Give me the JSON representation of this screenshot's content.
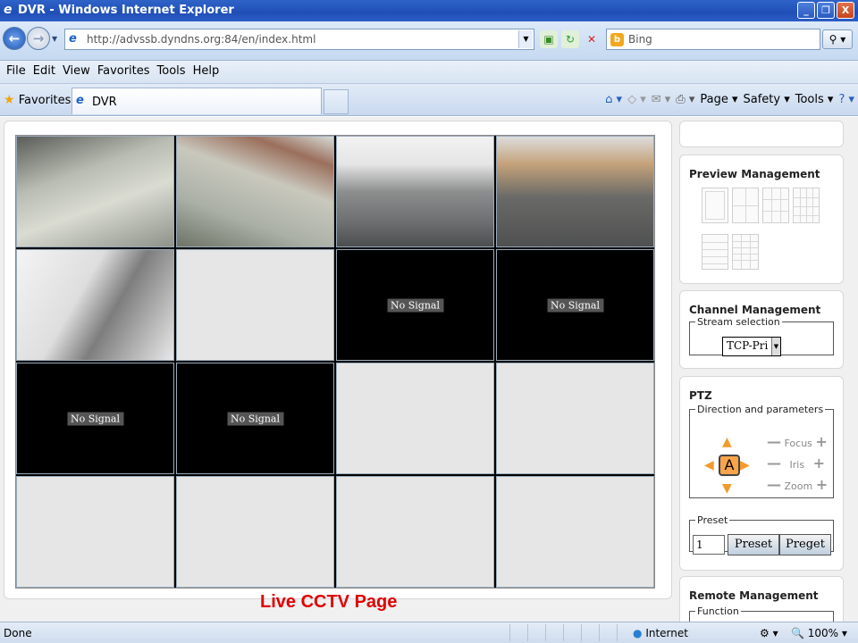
{
  "window": {
    "title": "DVR - Windows Internet Explorer",
    "min": "_",
    "max": "❐",
    "close": "X"
  },
  "address": {
    "url": "http://advssb.dyndns.org:84/en/index.html",
    "search_placeholder": "Bing"
  },
  "menu": [
    "File",
    "Edit",
    "View",
    "Favorites",
    "Tools",
    "Help"
  ],
  "favorites_bar": {
    "favorites_label": "Favorites",
    "tab_title": "DVR",
    "page_menu": "Page ▾",
    "safety_menu": "Safety ▾",
    "tools_menu": "Tools ▾",
    "help_menu": "? ▾"
  },
  "cameras": [
    {
      "type": "video",
      "scene": "cam1"
    },
    {
      "type": "video",
      "scene": "cam2"
    },
    {
      "type": "video",
      "scene": "cam3"
    },
    {
      "type": "video",
      "scene": "cam4"
    },
    {
      "type": "video",
      "scene": "cam5"
    },
    {
      "type": "empty"
    },
    {
      "type": "nosignal",
      "label": "No Signal"
    },
    {
      "type": "nosignal",
      "label": "No Signal"
    },
    {
      "type": "nosignal",
      "label": "No Signal"
    },
    {
      "type": "nosignal",
      "label": "No Signal"
    },
    {
      "type": "empty"
    },
    {
      "type": "empty"
    },
    {
      "type": "empty"
    },
    {
      "type": "empty"
    },
    {
      "type": "empty"
    },
    {
      "type": "empty"
    }
  ],
  "caption": "Live CCTV Page",
  "sidebar": {
    "preview_title": "Preview Management",
    "channel_title": "Channel Management",
    "stream_legend": "Stream selection",
    "stream_value": "TCP-Pri",
    "ptz_title": "PTZ",
    "direction_legend": "Direction and parameters",
    "center_label": "A",
    "focus_label": "Focus",
    "iris_label": "Iris",
    "zoom_label": "Zoom",
    "preset_legend": "Preset",
    "preset_value": "1",
    "preset_button": "Preset",
    "preget_button": "Preget",
    "remote_title": "Remote Management",
    "function_legend": "Function"
  },
  "status": {
    "text": "Done",
    "zone": "Internet",
    "zoom": "100%"
  },
  "colors": {
    "caption": "#e00000",
    "ptz_arrow": "#f39a2c",
    "titlebar": "#2f63c8"
  }
}
